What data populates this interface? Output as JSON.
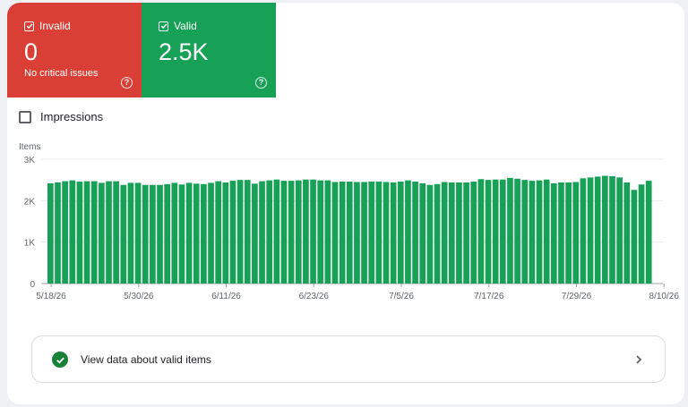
{
  "tiles": {
    "invalid": {
      "label": "Invalid",
      "value": "0",
      "subtext": "No critical issues",
      "color": "#d93f35",
      "checked": true,
      "help_icon": "question-icon"
    },
    "valid": {
      "label": "Valid",
      "value": "2.5K",
      "color": "#16a157",
      "checked": true,
      "help_icon": "question-icon"
    }
  },
  "impressions": {
    "label": "Impressions",
    "checked": false
  },
  "chart_data": {
    "type": "bar",
    "ylabel": "Items",
    "ylim": [
      0,
      3000
    ],
    "yticks": [
      "0",
      "1K",
      "2K",
      "3K"
    ],
    "ytick_values": [
      0,
      1000,
      2000,
      3000
    ],
    "xtick_labels": [
      "5/18/26",
      "5/30/26",
      "6/11/26",
      "6/23/26",
      "7/5/26",
      "7/17/26",
      "7/29/26",
      "8/10/26"
    ],
    "bar_color": "#16a157",
    "series": [
      {
        "values": [
          2420,
          2440,
          2470,
          2490,
          2460,
          2470,
          2470,
          2430,
          2470,
          2470,
          2380,
          2430,
          2430,
          2380,
          2380,
          2380,
          2400,
          2430,
          2390,
          2430,
          2410,
          2400,
          2430,
          2470,
          2440,
          2480,
          2500,
          2500,
          2410,
          2470,
          2490,
          2510,
          2480,
          2480,
          2490,
          2510,
          2510,
          2490,
          2490,
          2450,
          2460,
          2460,
          2450,
          2450,
          2460,
          2460,
          2450,
          2440,
          2460,
          2490,
          2460,
          2420,
          2380,
          2400,
          2450,
          2440,
          2440,
          2440,
          2460,
          2520,
          2500,
          2510,
          2510,
          2550,
          2530,
          2500,
          2480,
          2490,
          2510,
          2420,
          2440,
          2440,
          2450,
          2540,
          2560,
          2580,
          2600,
          2590,
          2560,
          2440,
          2260,
          2390,
          2480
        ]
      }
    ]
  },
  "view_link": {
    "label": "View data about valid items",
    "icon": "check-circle-icon",
    "chevron": "chevron-right-icon"
  }
}
